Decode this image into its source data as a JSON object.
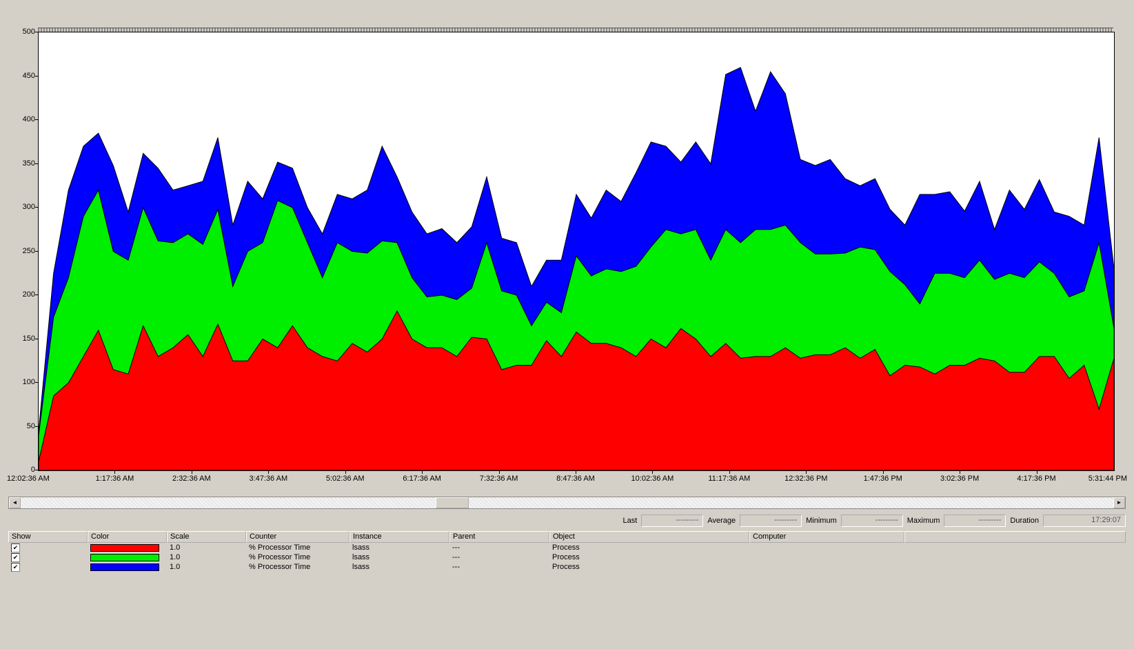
{
  "chart_data": {
    "type": "area",
    "ylim": [
      0,
      500
    ],
    "x_first": "12:02:36 AM",
    "x_last": "5:31:44 PM",
    "x_ticks": [
      "1:17:36 AM",
      "2:32:36 AM",
      "3:47:36 AM",
      "5:02:36 AM",
      "6:17:36 AM",
      "7:32:36 AM",
      "8:47:36 AM",
      "10:02:36 AM",
      "11:17:36 AM",
      "12:32:36 PM",
      "1:47:36 PM",
      "3:02:36 PM",
      "4:17:36 PM"
    ],
    "y_ticks": [
      0,
      50,
      100,
      150,
      200,
      250,
      300,
      350,
      400,
      450,
      500
    ],
    "series": [
      {
        "name": "lsass (red)",
        "color": "#ff0000",
        "values": [
          10,
          85,
          100,
          130,
          160,
          115,
          110,
          165,
          130,
          140,
          155,
          130,
          167,
          125,
          125,
          150,
          140,
          165,
          140,
          130,
          125,
          145,
          135,
          150,
          182,
          150,
          140,
          140,
          130,
          152,
          150,
          115,
          120,
          120,
          148,
          130,
          158,
          145,
          145,
          140,
          130,
          150,
          140,
          162,
          150,
          130,
          145,
          128,
          130,
          130,
          140,
          128,
          132,
          132,
          140,
          128,
          138,
          108,
          120,
          118,
          110,
          120,
          120,
          128,
          125,
          112,
          112,
          130,
          130,
          105,
          120,
          70,
          128
        ]
      },
      {
        "name": "lsass (green)",
        "color": "#00ee00",
        "values": [
          40,
          175,
          220,
          290,
          320,
          250,
          240,
          300,
          262,
          260,
          270,
          258,
          298,
          210,
          250,
          260,
          308,
          300,
          260,
          220,
          260,
          250,
          248,
          262,
          260,
          220,
          198,
          200,
          195,
          208,
          260,
          205,
          200,
          165,
          192,
          180,
          245,
          222,
          230,
          227,
          233,
          255,
          275,
          270,
          275,
          240,
          275,
          260,
          275,
          275,
          280,
          260,
          247,
          247,
          248,
          255,
          252,
          227,
          212,
          190,
          225,
          225,
          220,
          240,
          218,
          225,
          220,
          238,
          225,
          198,
          205,
          260,
          162
        ]
      },
      {
        "name": "lsass (blue)",
        "color": "#0000ff",
        "values": [
          45,
          225,
          320,
          370,
          385,
          348,
          295,
          362,
          345,
          320,
          325,
          330,
          380,
          280,
          330,
          310,
          352,
          345,
          300,
          270,
          315,
          310,
          320,
          370,
          335,
          295,
          270,
          276,
          260,
          278,
          335,
          265,
          260,
          210,
          240,
          240,
          315,
          288,
          320,
          307,
          340,
          375,
          370,
          352,
          375,
          350,
          452,
          460,
          410,
          455,
          430,
          355,
          348,
          355,
          333,
          325,
          333,
          298,
          280,
          315,
          315,
          318,
          296,
          330,
          275,
          320,
          298,
          332,
          295,
          290,
          280,
          380,
          230
        ]
      }
    ]
  },
  "scroll": {
    "left_arrow": "◄",
    "right_arrow": "►"
  },
  "stats": {
    "labels": {
      "last": "Last",
      "average": "Average",
      "minimum": "Minimum",
      "maximum": "Maximum",
      "duration": "Duration"
    },
    "values": {
      "last": "---------",
      "average": "---------",
      "minimum": "---------",
      "maximum": "---------",
      "duration": "17:29:07"
    }
  },
  "grid": {
    "headers": {
      "show": "Show",
      "color": "Color",
      "scale": "Scale",
      "counter": "Counter",
      "instance": "Instance",
      "parent": "Parent",
      "object": "Object",
      "computer": "Computer"
    },
    "rows": [
      {
        "checked": "✔",
        "color": "#ff0000",
        "scale": "1.0",
        "counter": "% Processor Time",
        "instance": "lsass",
        "parent": "---",
        "object": "Process",
        "computer": ""
      },
      {
        "checked": "✔",
        "color": "#00ee00",
        "scale": "1.0",
        "counter": "% Processor Time",
        "instance": "lsass",
        "parent": "---",
        "object": "Process",
        "computer": ""
      },
      {
        "checked": "✔",
        "color": "#0000ff",
        "scale": "1.0",
        "counter": "% Processor Time",
        "instance": "lsass",
        "parent": "---",
        "object": "Process",
        "computer": ""
      }
    ]
  }
}
